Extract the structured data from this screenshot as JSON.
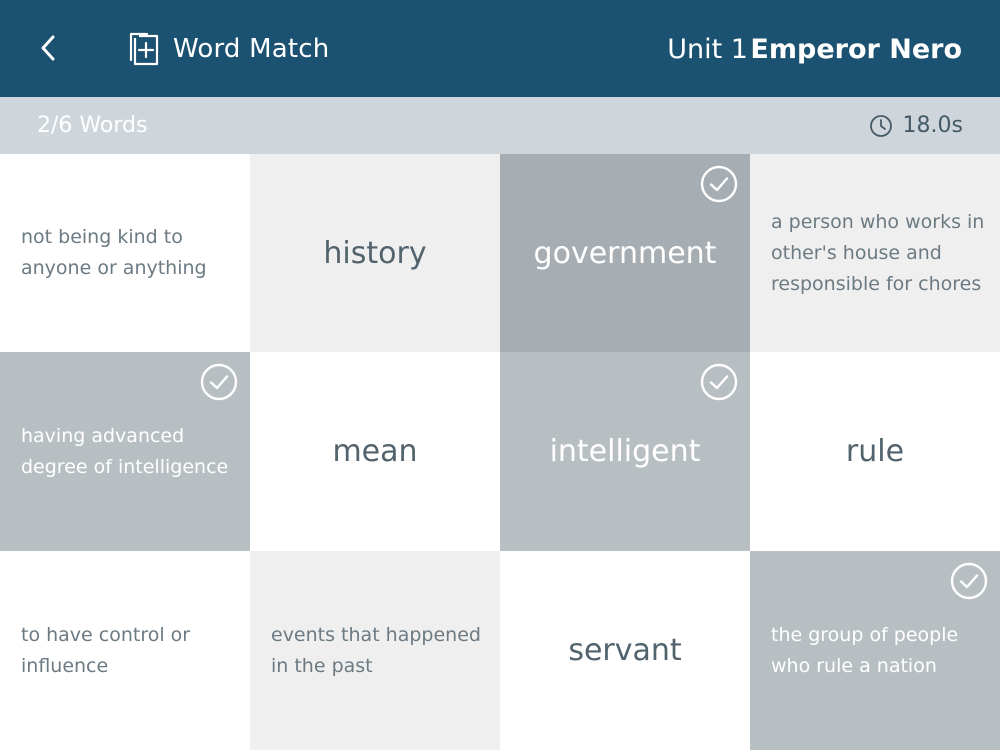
{
  "header": {
    "brand_title": "Word Match",
    "unit": "Unit 1",
    "lesson": "Emperor Nero"
  },
  "status": {
    "progress": "2/6 Words",
    "timer": "18.0s"
  },
  "icons": {
    "back": "chevron-left-icon",
    "brand": "add-card-icon",
    "timer": "clock-icon",
    "check": "check-circle-icon"
  },
  "colors": {
    "header_bg": "#1b5171",
    "status_bg": "#cfd6db",
    "cell_white": "#ffffff",
    "cell_light": "#efefef",
    "cell_matched_word": "#a6aeb3",
    "cell_matched": "#b8bfc3"
  },
  "cards": [
    {
      "type": "definition",
      "text": "not being kind to anyone or anything",
      "state": "default"
    },
    {
      "type": "word",
      "text": "history",
      "state": "default"
    },
    {
      "type": "word",
      "text": "government",
      "state": "matched"
    },
    {
      "type": "definition",
      "text": "a person who works in other's house and responsible for chores",
      "state": "default"
    },
    {
      "type": "definition",
      "text": "having advanced degree of intelligence",
      "state": "matched"
    },
    {
      "type": "word",
      "text": "mean",
      "state": "default"
    },
    {
      "type": "word",
      "text": "intelligent",
      "state": "matched"
    },
    {
      "type": "word",
      "text": "rule",
      "state": "default"
    },
    {
      "type": "definition",
      "text": "to have control or influence",
      "state": "default"
    },
    {
      "type": "definition",
      "text": "events that happened in the past",
      "state": "default"
    },
    {
      "type": "word",
      "text": "servant",
      "state": "default"
    },
    {
      "type": "definition",
      "text": "the group of people who rule a nation",
      "state": "matched"
    }
  ]
}
